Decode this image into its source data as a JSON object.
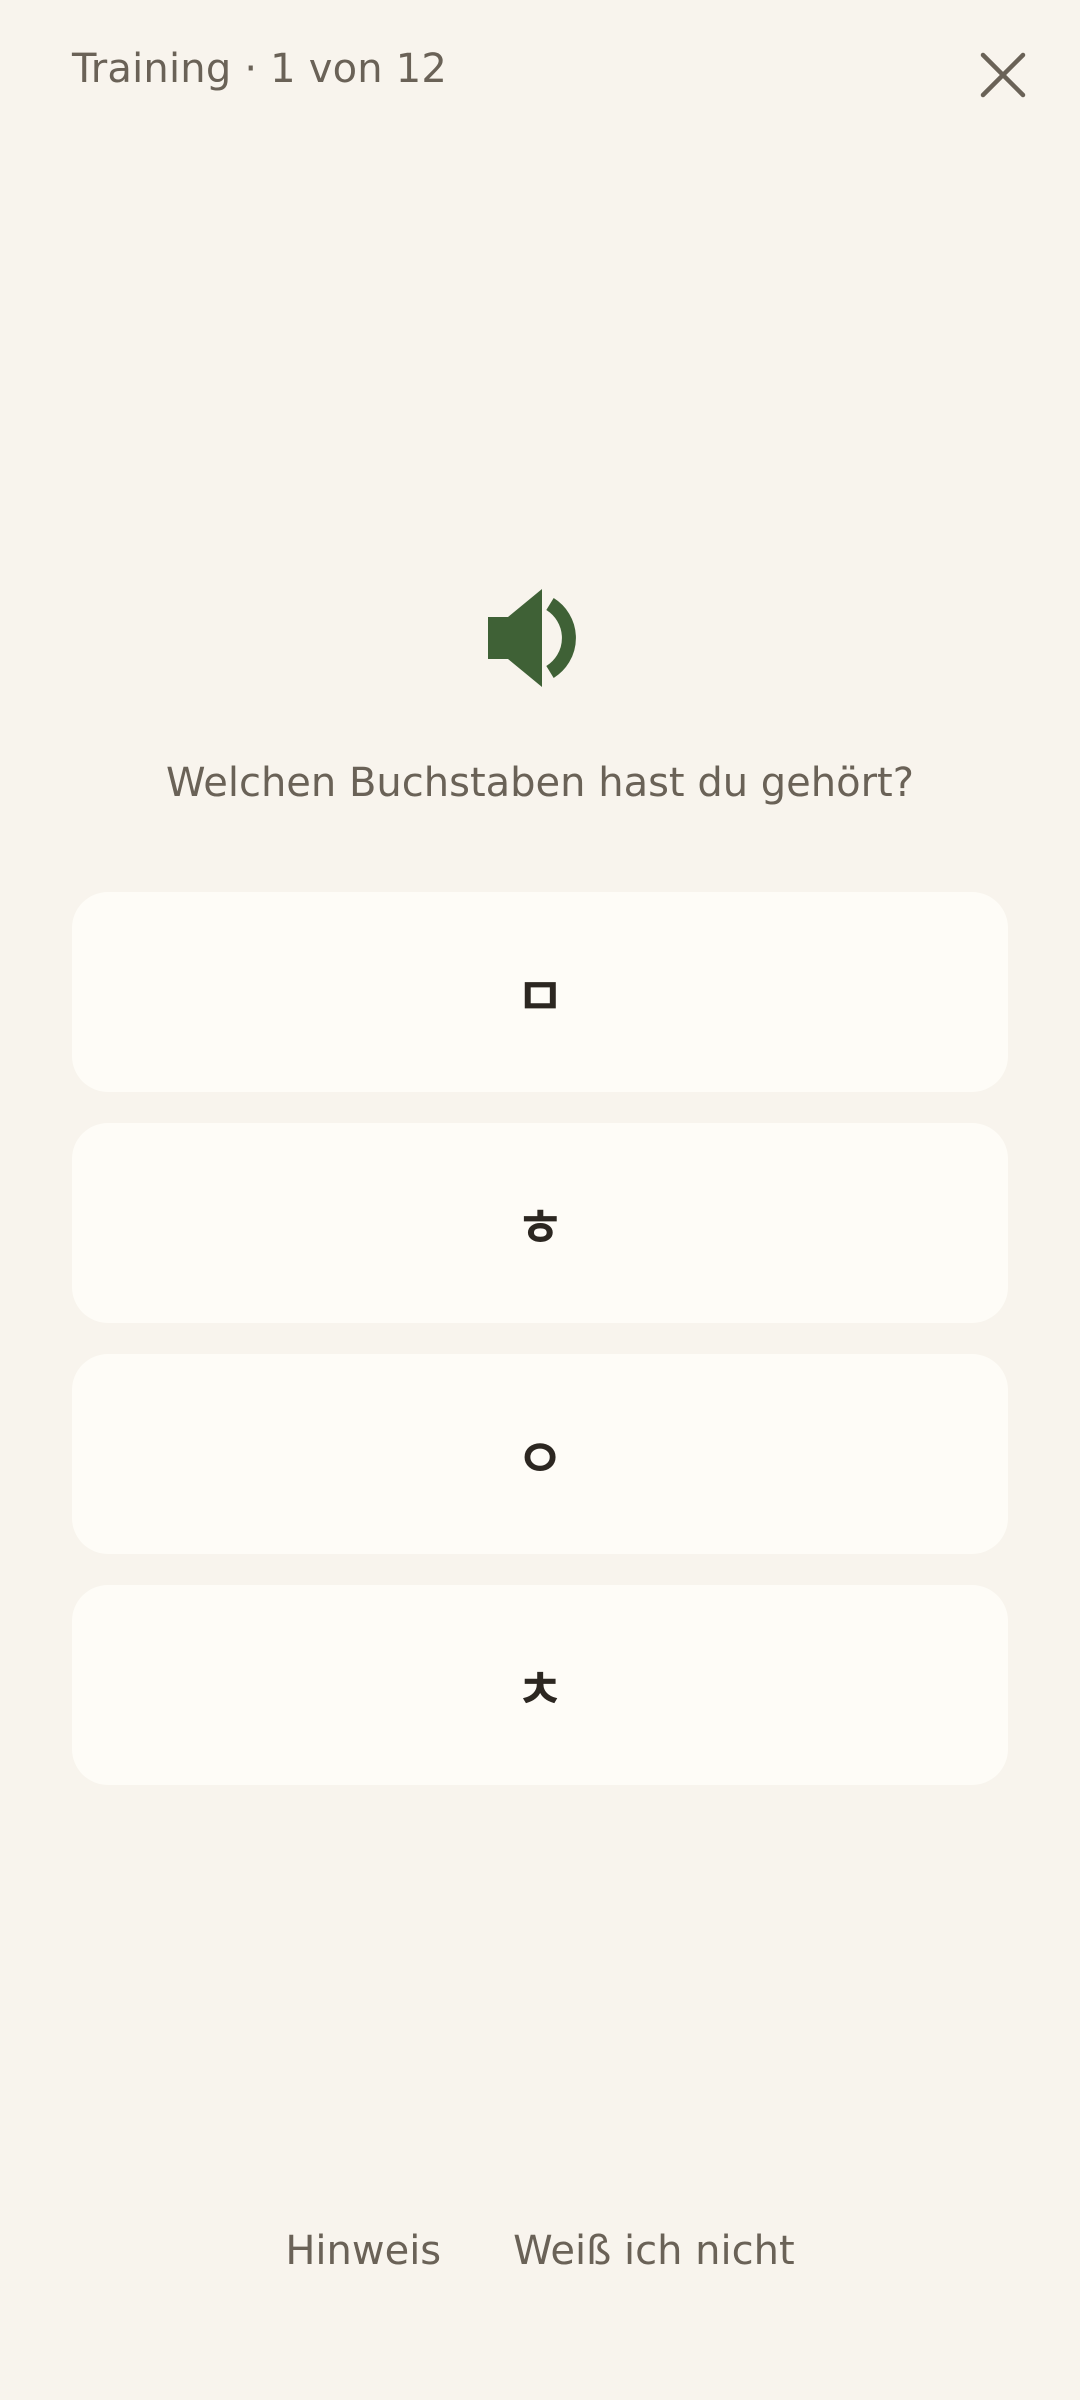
{
  "header": {
    "title": "Training · 1 von 12"
  },
  "audio": {
    "icon": "speaker-icon"
  },
  "prompt": {
    "text": "Welchen Buchstaben hast du gehört?"
  },
  "options": [
    {
      "label": "ㅁ"
    },
    {
      "label": "ㅎ"
    },
    {
      "label": "ㅇ"
    },
    {
      "label": "ㅊ"
    }
  ],
  "footer": {
    "hint_label": "Hinweis",
    "skip_label": "Weiß ich nicht"
  },
  "colors": {
    "background": "#f8f4ed",
    "card": "#fefcf7",
    "accent": "#3f6136",
    "text_muted": "#6a6257",
    "text_strong": "#2c2721"
  }
}
